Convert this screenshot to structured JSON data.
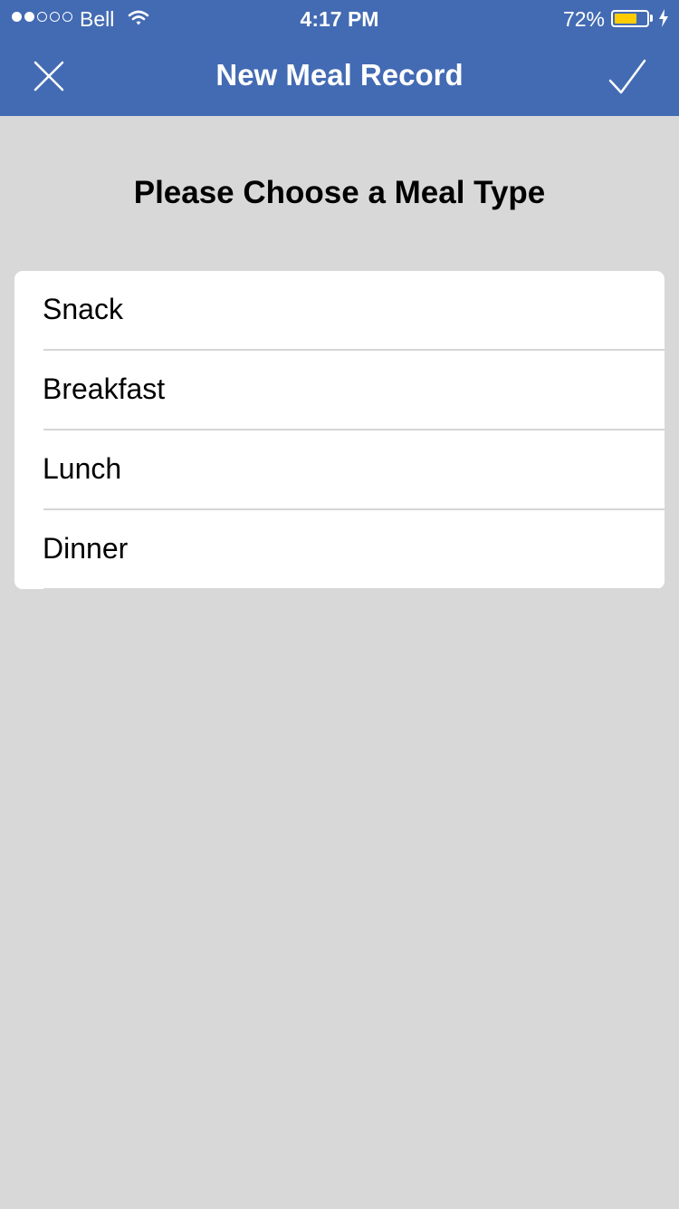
{
  "status_bar": {
    "carrier": "Bell",
    "signal_filled": 2,
    "signal_total": 5,
    "time": "4:17 PM",
    "battery_percent": "72%",
    "battery_level": 0.72,
    "charging": true,
    "battery_color": "#ffcc00"
  },
  "nav": {
    "title": "New Meal Record",
    "left_icon": "close-icon",
    "right_icon": "checkmark-icon",
    "background": "#436bb3"
  },
  "main": {
    "prompt": "Please Choose a Meal Type",
    "meal_types": [
      "Snack",
      "Breakfast",
      "Lunch",
      "Dinner"
    ],
    "background": "#d8d8d8"
  }
}
